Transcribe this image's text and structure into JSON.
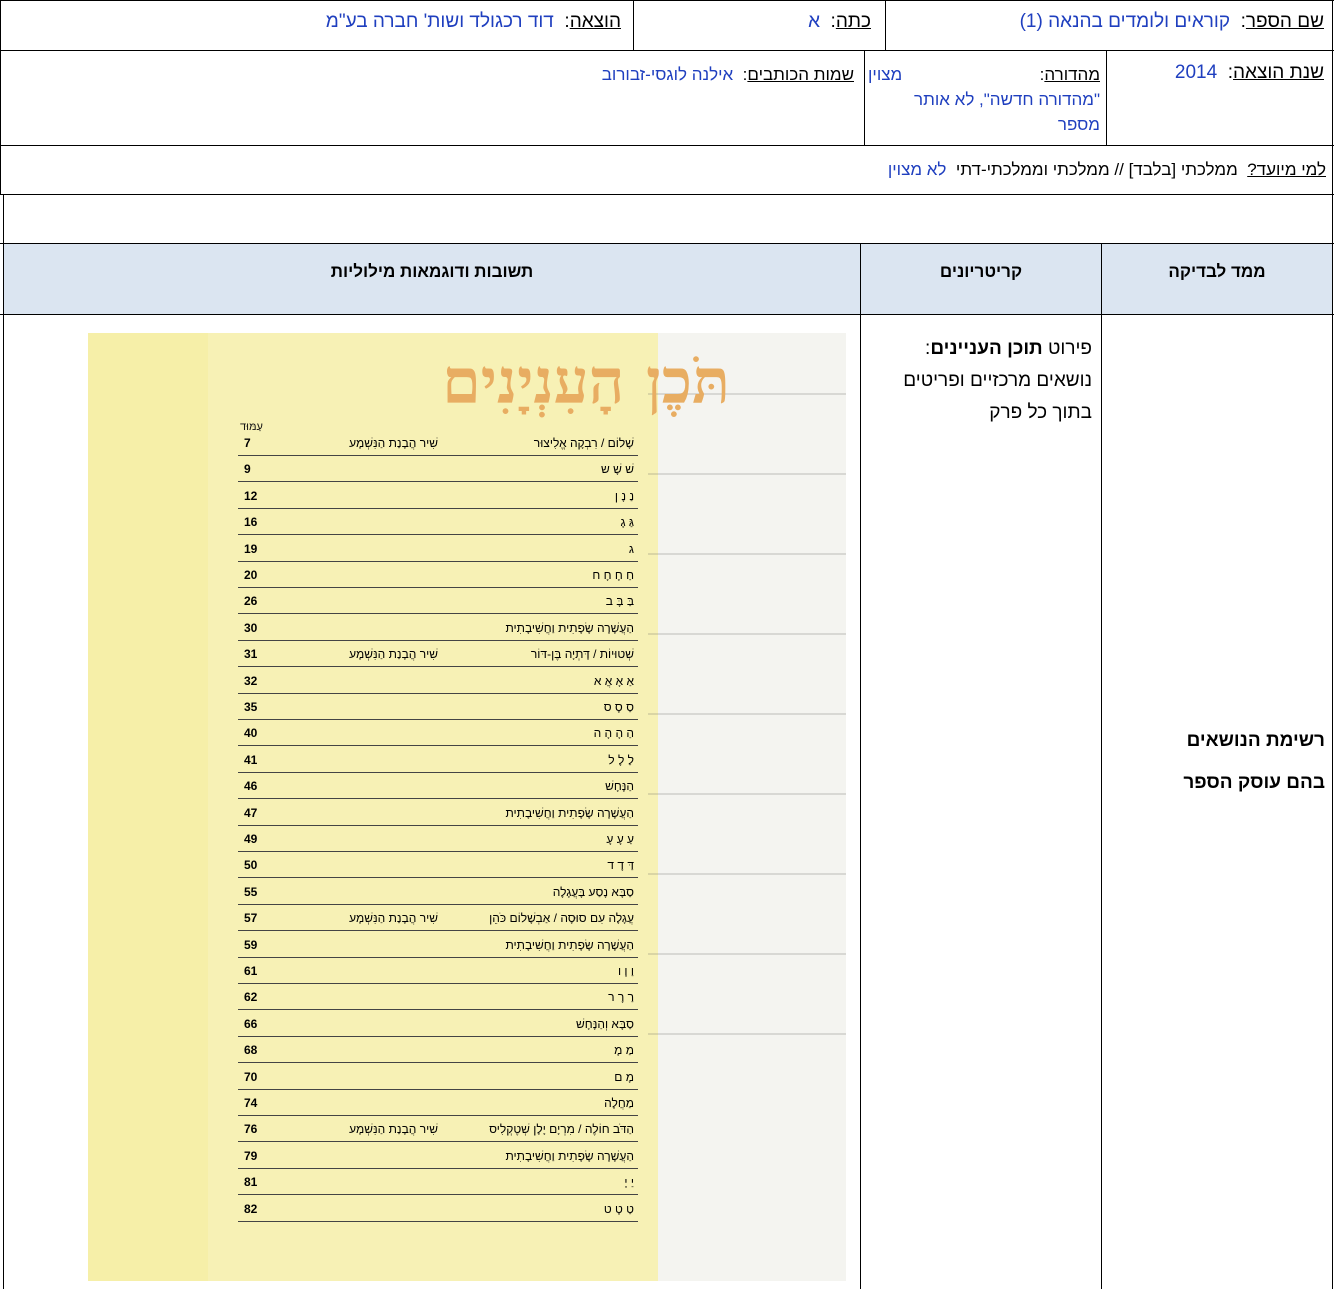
{
  "info": {
    "book_name_label": "שם הספר",
    "book_name_value": "קוראים ולומדים בהנאה (1)",
    "grade_label": "כתה",
    "grade_value": "א",
    "publisher_label": "הוצאה",
    "publisher_value": "דוד רכגולד ושות' חברה בע\"מ",
    "year_label": "שנת הוצאה",
    "year_value": "2014",
    "edition_label": "מהדורה",
    "edition_value_1": "מצוין",
    "edition_value_2": "\"מהדורה חדשה\", לא אותר מספר",
    "authors_label": "שמות הכותבים",
    "authors_value": "אילנה לוגסי-זבורוב",
    "audience_label": "למי מיועד?",
    "audience_text": "ממלכתי [בלבד] // ממלכתי וממלכתי-דתי",
    "audience_value": "לא מצוין"
  },
  "table_headers": {
    "dimension": "ממד לבדיקה",
    "criteria": "קריטריונים",
    "answers": "תשובות ודוגמאות מילוליות"
  },
  "row": {
    "criteria_prefix": "פירוט",
    "criteria_bold": "תוכן העניינים",
    "criteria_rest": "נושאים מרכזיים ופריטים בתוך כל פרק",
    "dimension_line1": "רשימת הנושאים",
    "dimension_line2": "בהם עוסק הספר"
  },
  "scan": {
    "title": "תֹּכֶן הָעִנְיָנִים",
    "page_header": "עַמּוּד",
    "entries": [
      {
        "text": "שָׁלוֹם / רִבְקָה אֱלִיצוּר",
        "mid": "שִׁיר   הֲבָנַת הַנִּשְׁמָע",
        "page": "7"
      },
      {
        "text": "שׁ שָׁ ש",
        "mid": "",
        "page": "9"
      },
      {
        "text": "נַ נָ ן",
        "mid": "",
        "page": "12"
      },
      {
        "text": "גַּ גָ",
        "mid": "",
        "page": "16"
      },
      {
        "text": "ג",
        "mid": "",
        "page": "19"
      },
      {
        "text": "חַ חָ חָ ח",
        "mid": "",
        "page": "20"
      },
      {
        "text": "בַּ בָּ ב",
        "mid": "",
        "page": "26"
      },
      {
        "text": "הַעֲשָׁרָה שָׂפָתִית וַחֲשִׁיבָתִית",
        "mid": "",
        "page": "30"
      },
      {
        "text": "שְׁטוּיוֹת / דָּתְיָה בֶּן-דּוֹר",
        "mid": "שִׁיר   הֲבָנַת הַנִּשְׁמָע",
        "page": "31"
      },
      {
        "text": "אַ אָ אֲ א",
        "mid": "",
        "page": "32"
      },
      {
        "text": "סַ סָ ס",
        "mid": "",
        "page": "35"
      },
      {
        "text": "הַ הָ הָ ה",
        "mid": "",
        "page": "40"
      },
      {
        "text": "לַ לָ ל",
        "mid": "",
        "page": "41"
      },
      {
        "text": "הַנָּחָשׁ",
        "mid": "",
        "page": "46"
      },
      {
        "text": "הַעֲשָׁרָה שָׂפָתִית וַחֲשִׁיבָתִית",
        "mid": "",
        "page": "47"
      },
      {
        "text": "עַ עָ עָ",
        "mid": "",
        "page": "49"
      },
      {
        "text": "דַּ דָ ד",
        "mid": "",
        "page": "50"
      },
      {
        "text": "סַבָּא נָסַע בָּעֲגָלָה",
        "mid": "",
        "page": "55"
      },
      {
        "text": "עֲגָלָה עִם סוּסָה / אַבְשָׁלוֹם כֹּהֵן",
        "mid": "שִׁיר   הֲבָנַת הַנִּשְׁמָע",
        "page": "57"
      },
      {
        "text": "הַעֲשָׁרָה שָׂפָתִית וַחֲשִׁיבָתִית",
        "mid": "",
        "page": "59"
      },
      {
        "text": "וַ וָ ו",
        "mid": "",
        "page": "61"
      },
      {
        "text": "רַ רָ ר",
        "mid": "",
        "page": "62"
      },
      {
        "text": "סַבָּא וְהַנָּחָשׁ",
        "mid": "",
        "page": "66"
      },
      {
        "text": "מַ מָ",
        "mid": "",
        "page": "68"
      },
      {
        "text": "מָ ם",
        "mid": "",
        "page": "70"
      },
      {
        "text": "מַחֲלָה",
        "mid": "",
        "page": "74"
      },
      {
        "text": "הַדֹּב חוֹלֶה / מִרְיָם יָלָן שְׁטֶקְלִיס",
        "mid": "שִׁיר   הֲבָנַת הַנִּשְׁמָע",
        "page": "76"
      },
      {
        "text": "הַעֲשָׁרָה שָׂפָתִית וַחֲשִׁיבָתִית",
        "mid": "",
        "page": "79"
      },
      {
        "text": "יַ יָ",
        "mid": "",
        "page": "81"
      },
      {
        "text": "טַ טָ ט",
        "mid": "",
        "page": "82"
      }
    ]
  },
  "colors": {
    "value_text": "#1f3fbf",
    "header_bg": "#dbe5f1",
    "scan_paper": "#fbf7e1",
    "scan_yellow": "#f6efa8",
    "scan_title": "#e8ad62"
  }
}
